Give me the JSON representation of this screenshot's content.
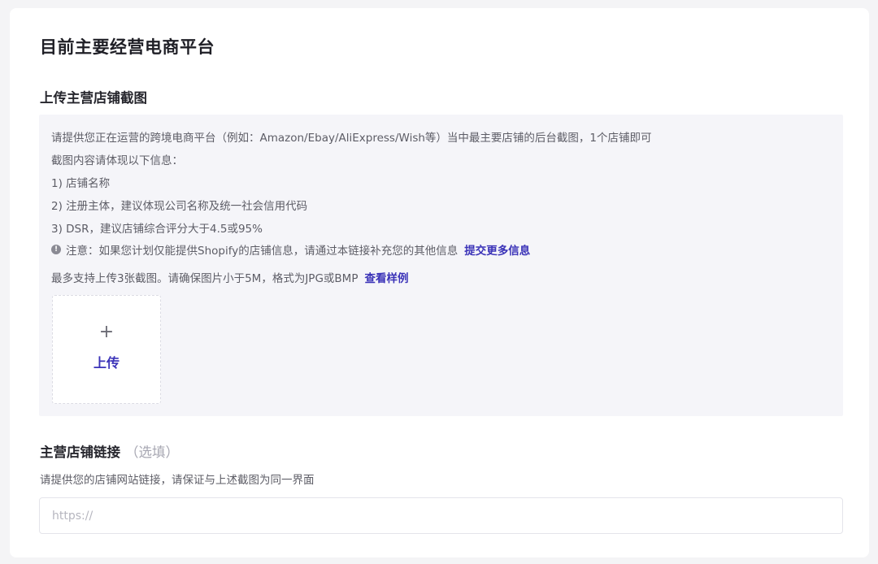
{
  "page": {
    "title": "目前主要经营电商平台"
  },
  "screenshot_section": {
    "title": "上传主营店铺截图",
    "lines": [
      "请提供您正在运营的跨境电商平台（例如：Amazon/Ebay/AliExpress/Wish等）当中最主要店铺的后台截图，1个店铺即可",
      "截图内容请体现以下信息：",
      "1) 店铺名称",
      "2) 注册主体，建议体现公司名称及统一社会信用代码",
      "3) DSR，建议店铺综合评分大于4.5或95%"
    ],
    "notice_icon": "info-icon",
    "notice_text": "注意：如果您计划仅能提供Shopify的店铺信息，请通过本链接补充您的其他信息",
    "notice_link": "提交更多信息",
    "limit_text": "最多支持上传3张截图。请确保图片小于5M，格式为JPG或BMP",
    "example_link": "查看样例",
    "upload": {
      "icon": "plus-icon",
      "label": "上传"
    }
  },
  "link_section": {
    "title": "主营店铺链接",
    "optional": "（选填）",
    "hint": "请提供您的店铺网站链接，请保证与上述截图为同一界面",
    "input": {
      "value": "",
      "placeholder": "https://"
    }
  },
  "colors": {
    "accent": "#3b33b8",
    "info_box_bg": "#f5f5f9",
    "page_bg": "#f4f4f6"
  }
}
